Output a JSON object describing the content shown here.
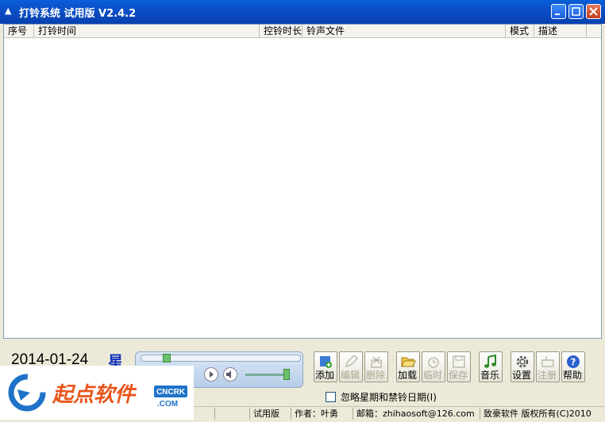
{
  "window": {
    "icon": "bell-icon",
    "title": "打铃系统 试用版 V2.4.2"
  },
  "list": {
    "columns": [
      "序号",
      "打铃时间",
      "控铃时长",
      "铃声文件",
      "模式",
      "描述"
    ]
  },
  "clock": {
    "date": "2014-01-24",
    "weekday": "星"
  },
  "toolbar": {
    "add": "添加",
    "edit": "编辑",
    "delete": "删除",
    "load": "加载",
    "temp": "临时",
    "save": "保存",
    "music": "音乐",
    "settings": "设置",
    "register": "注册",
    "help": "帮助"
  },
  "options": {
    "ignore_week_holiday": "忽略星期和禁铃日期(I)"
  },
  "status": {
    "edition": "试用版",
    "author": "作者：叶勇",
    "email": "邮箱：zhihaosoft@126.com",
    "copyright": "致豪软件 版权所有(C)2010"
  },
  "watermark": {
    "brand": "起点软件",
    "badge": "CNCRK",
    "badge_sub": ".COM"
  },
  "colors": {
    "titlebar": "#0b4fc7",
    "accent_blue": "#1133bb",
    "watermark_red": "#e8541a"
  }
}
